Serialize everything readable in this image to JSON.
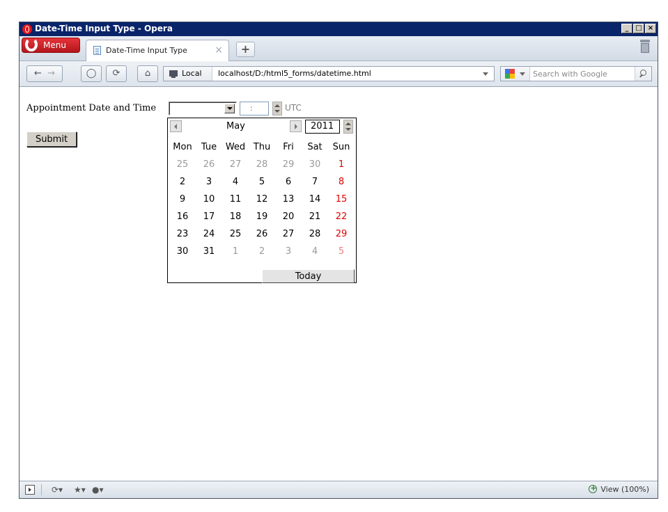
{
  "window": {
    "title": "Date-Time Input Type - Opera",
    "controls": [
      "_",
      "□",
      "×"
    ]
  },
  "tabbar": {
    "menu_label": "Menu",
    "tabs": [
      {
        "label": "Date-Time Input Type"
      }
    ],
    "close_glyph": "×",
    "new_tab_glyph": "+"
  },
  "navbar": {
    "buttons": [
      "back-icon",
      "forward-icon",
      "key-icon",
      "reload-icon",
      "home-icon"
    ],
    "local_label": "Local",
    "url": "localhost/D:/html5_forms/datetime.html",
    "search_placeholder": "Search with Google"
  },
  "form": {
    "label": "Appointment Date and Time",
    "date_value": "",
    "time_value": ":",
    "timezone": "UTC",
    "submit_label": "Submit"
  },
  "calendar": {
    "month": "May",
    "year": "2011",
    "weekdays": [
      "Mon",
      "Tue",
      "Wed",
      "Thu",
      "Fri",
      "Sat",
      "Sun"
    ],
    "weeks": [
      [
        {
          "d": "25",
          "o": true
        },
        {
          "d": "26",
          "o": true
        },
        {
          "d": "27",
          "o": true
        },
        {
          "d": "28",
          "o": true
        },
        {
          "d": "29",
          "o": true
        },
        {
          "d": "30",
          "o": true
        },
        {
          "d": "1",
          "o": false
        }
      ],
      [
        {
          "d": "2",
          "o": false
        },
        {
          "d": "3",
          "o": false
        },
        {
          "d": "4",
          "o": false
        },
        {
          "d": "5",
          "o": false
        },
        {
          "d": "6",
          "o": false
        },
        {
          "d": "7",
          "o": false
        },
        {
          "d": "8",
          "o": false
        }
      ],
      [
        {
          "d": "9",
          "o": false
        },
        {
          "d": "10",
          "o": false
        },
        {
          "d": "11",
          "o": false
        },
        {
          "d": "12",
          "o": false
        },
        {
          "d": "13",
          "o": false
        },
        {
          "d": "14",
          "o": false
        },
        {
          "d": "15",
          "o": false
        }
      ],
      [
        {
          "d": "16",
          "o": false
        },
        {
          "d": "17",
          "o": false
        },
        {
          "d": "18",
          "o": false
        },
        {
          "d": "19",
          "o": false
        },
        {
          "d": "20",
          "o": false
        },
        {
          "d": "21",
          "o": false
        },
        {
          "d": "22",
          "o": false
        }
      ],
      [
        {
          "d": "23",
          "o": false
        },
        {
          "d": "24",
          "o": false
        },
        {
          "d": "25",
          "o": false
        },
        {
          "d": "26",
          "o": false
        },
        {
          "d": "27",
          "o": false
        },
        {
          "d": "28",
          "o": false
        },
        {
          "d": "29",
          "o": false
        }
      ],
      [
        {
          "d": "30",
          "o": false
        },
        {
          "d": "31",
          "o": false
        },
        {
          "d": "1",
          "o": true
        },
        {
          "d": "2",
          "o": true
        },
        {
          "d": "3",
          "o": true
        },
        {
          "d": "4",
          "o": true
        },
        {
          "d": "5",
          "o": true
        }
      ]
    ],
    "today_label": "Today",
    "sunday_color": "#e00000"
  },
  "statusbar": {
    "zoom_label": "View (100%)"
  }
}
